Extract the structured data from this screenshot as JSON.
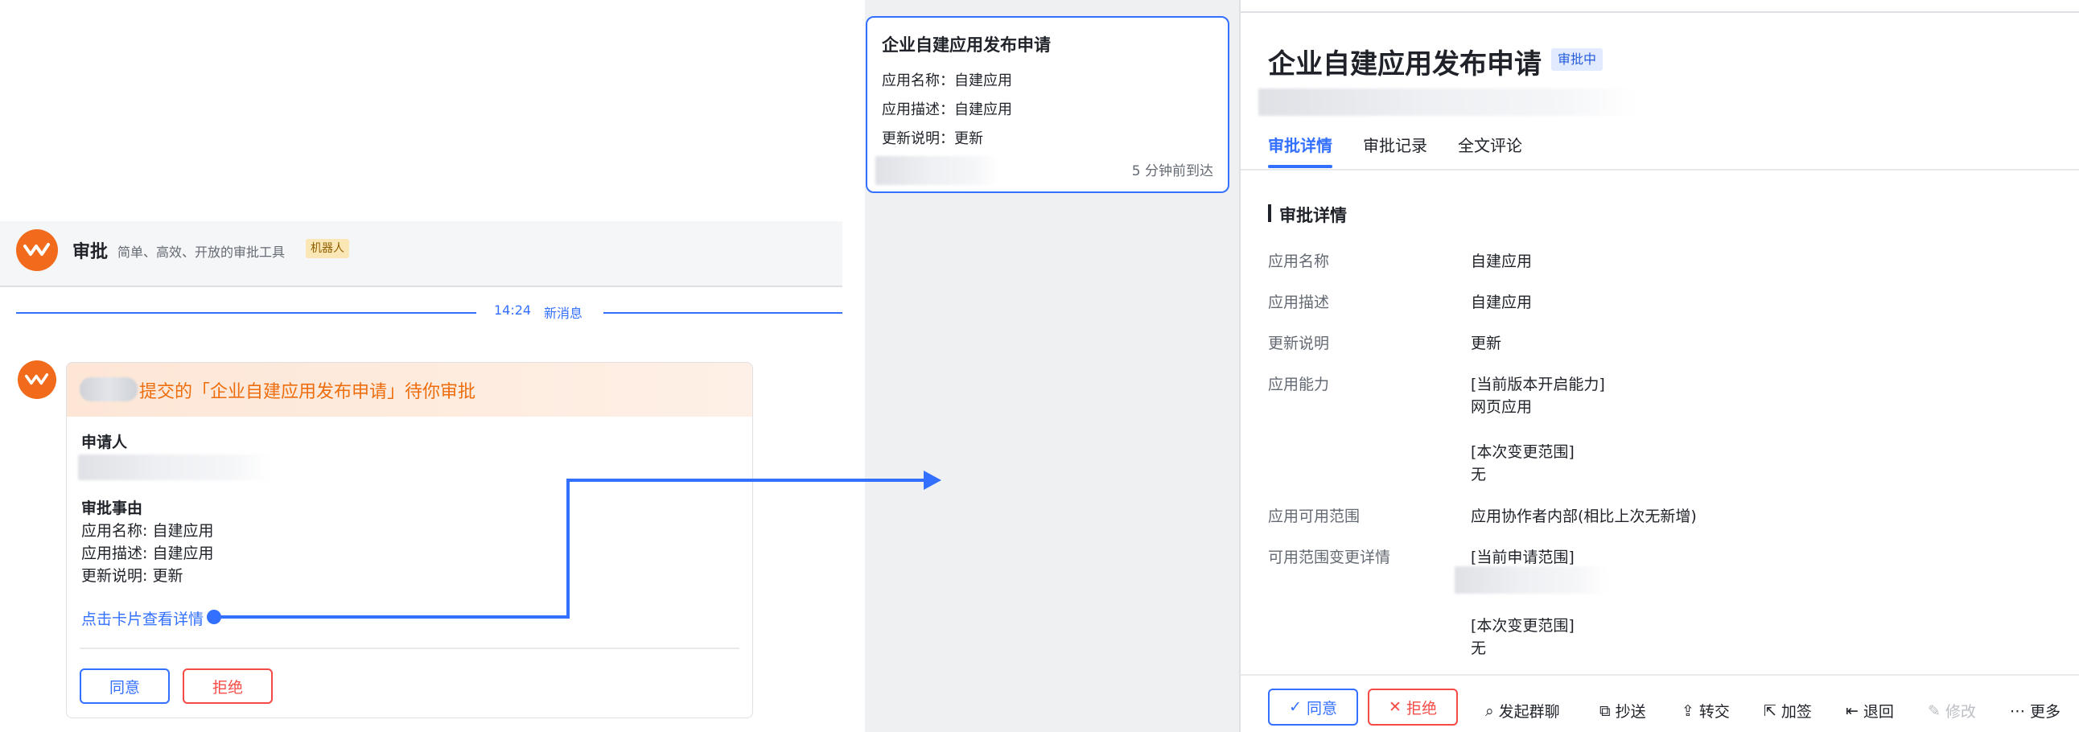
{
  "chat": {
    "bot_name": "审批",
    "bot_desc": "简单、高效、开放的审批工具",
    "bot_badge": "机器人",
    "divider_time": "14:24",
    "divider_label": "新消息",
    "card": {
      "title": "提交的「企业自建应用发布申请」待你审批",
      "applicant_label": "申请人",
      "reason_label": "审批事由",
      "lines": [
        "应用名称: 自建应用",
        "应用描述: 自建应用",
        "更新说明: 更新"
      ],
      "link": "点击卡片查看详情",
      "agree": "同意",
      "reject": "拒绝"
    }
  },
  "mini_card": {
    "title": "企业自建应用发布申请",
    "rows": [
      "应用名称：自建应用",
      "应用描述：自建应用",
      "更新说明：更新"
    ],
    "time": "5 分钟前到达"
  },
  "detail": {
    "title": "企业自建应用发布申请",
    "status": "审批中",
    "tabs": [
      "审批详情",
      "审批记录",
      "全文评论"
    ],
    "section_title": "审批详情",
    "fields": [
      {
        "label": "应用名称",
        "value": "自建应用"
      },
      {
        "label": "应用描述",
        "value": "自建应用"
      },
      {
        "label": "更新说明",
        "value": "更新"
      },
      {
        "label": "应用能力",
        "value": "[当前版本开启能力]"
      },
      {
        "label": "",
        "value": "网页应用"
      },
      {
        "label": "",
        "value": "[本次变更范围]"
      },
      {
        "label": "",
        "value": "无"
      },
      {
        "label": "应用可用范围",
        "value": "应用协作者内部(相比上次无新增)"
      },
      {
        "label": "可用范围变更详情",
        "value": "[当前申请范围]"
      },
      {
        "label": "",
        "value": "[本次变更范围]"
      },
      {
        "label": "",
        "value": "无"
      }
    ],
    "actions": {
      "agree": "同意",
      "reject": "拒绝",
      "group_chat": "发起群聊",
      "cc": "抄送",
      "transfer": "转交",
      "add_sign": "加签",
      "return": "退回",
      "modify": "修改",
      "more": "更多"
    }
  },
  "colors": {
    "accent": "#3370ff",
    "orange": "#ed6d0c",
    "danger": "#f54a45"
  }
}
